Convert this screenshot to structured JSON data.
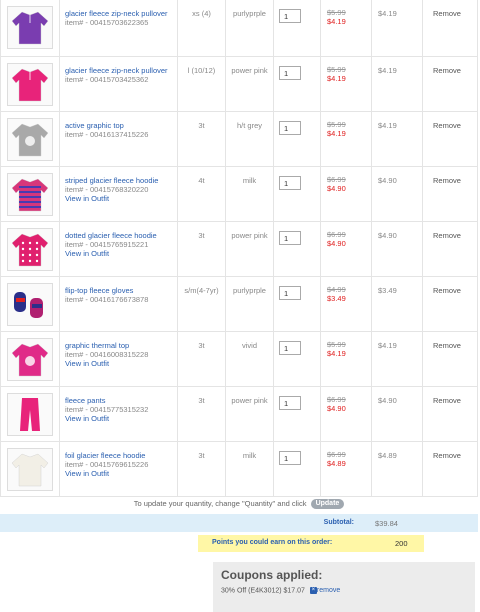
{
  "items": [
    {
      "name": "glacier fleece zip-neck pullover",
      "item_no": "item# - 00415703622365",
      "outfit": "",
      "size": "xs (4)",
      "color": "purlyprple",
      "qty": "1",
      "was": "$5.99",
      "now": "$4.19",
      "total": "$4.19",
      "remove": "Remove",
      "img_icon": "purple-zip-pullover-thumbnail",
      "img_color": "#7a3db0"
    },
    {
      "name": "glacier fleece zip-neck pullover",
      "item_no": "item# - 00415703425362",
      "outfit": "",
      "size": "l (10/12)",
      "color": "power pink",
      "qty": "1",
      "was": "$5.99",
      "now": "$4.19",
      "total": "$4.19",
      "remove": "Remove",
      "img_icon": "pink-zip-pullover-thumbnail",
      "img_color": "#e8237a"
    },
    {
      "name": "active graphic top",
      "item_no": "item# - 00416137415226",
      "outfit": "",
      "size": "3t",
      "color": "h/t grey",
      "qty": "1",
      "was": "$5.99",
      "now": "$4.19",
      "total": "$4.19",
      "remove": "Remove",
      "img_icon": "grey-graphic-top-thumbnail",
      "img_color": "#a9a9a9"
    },
    {
      "name": "striped glacier fleece hoodie",
      "item_no": "item# - 00415768320220",
      "outfit": "View in Outfit",
      "size": "4t",
      "color": "milk",
      "qty": "1",
      "was": "$6.99",
      "now": "$4.90",
      "total": "$4.90",
      "remove": "Remove",
      "img_icon": "striped-hoodie-thumbnail",
      "img_color": "#d8367a"
    },
    {
      "name": "dotted glacier fleece hoodie",
      "item_no": "item# - 00415765915221",
      "outfit": "View in Outfit",
      "size": "3t",
      "color": "power pink",
      "qty": "1",
      "was": "$6.99",
      "now": "$4.90",
      "total": "$4.90",
      "remove": "Remove",
      "img_icon": "dotted-hoodie-thumbnail",
      "img_color": "#e0206e"
    },
    {
      "name": "flip-top fleece gloves",
      "item_no": "item# - 00416176673878",
      "outfit": "",
      "size": "s/m(4-7yr)",
      "color": "purlyprple",
      "qty": "1",
      "was": "$4.99",
      "now": "$3.49",
      "total": "$3.49",
      "remove": "Remove",
      "img_icon": "gloves-thumbnail",
      "img_color": "#5a3a9a"
    },
    {
      "name": "graphic thermal top",
      "item_no": "item# - 00416008315228",
      "outfit": "View in Outfit",
      "size": "3t",
      "color": "vivid",
      "qty": "1",
      "was": "$5.99",
      "now": "$4.19",
      "total": "$4.19",
      "remove": "Remove",
      "img_icon": "pink-thermal-top-thumbnail",
      "img_color": "#e02a88"
    },
    {
      "name": "fleece pants",
      "item_no": "item# - 00415775315232",
      "outfit": "View in Outfit",
      "size": "3t",
      "color": "power pink",
      "qty": "1",
      "was": "$6.99",
      "now": "$4.90",
      "total": "$4.90",
      "remove": "Remove",
      "img_icon": "pink-pants-thumbnail",
      "img_color": "#e8237a"
    },
    {
      "name": "foil glacier fleece hoodie",
      "item_no": "item# - 00415769615226",
      "outfit": "View in Outfit",
      "size": "3t",
      "color": "milk",
      "qty": "1",
      "was": "$6.99",
      "now": "$4.89",
      "total": "$4.89",
      "remove": "Remove",
      "img_icon": "white-hoodie-thumbnail",
      "img_color": "#f2efe6"
    }
  ],
  "update": {
    "text": "To update your quantity, change \"Quantity\" and click",
    "button": "Update"
  },
  "subtotal": {
    "label": "Subtotal:",
    "value": "$39.84"
  },
  "points": {
    "label": "Points you could earn on this order:",
    "value": "200"
  },
  "coupons": {
    "title": "Coupons applied:",
    "line": "30% Off (E4K3012) $17.07",
    "remove": "remove",
    "remove_icon": "x-icon"
  }
}
